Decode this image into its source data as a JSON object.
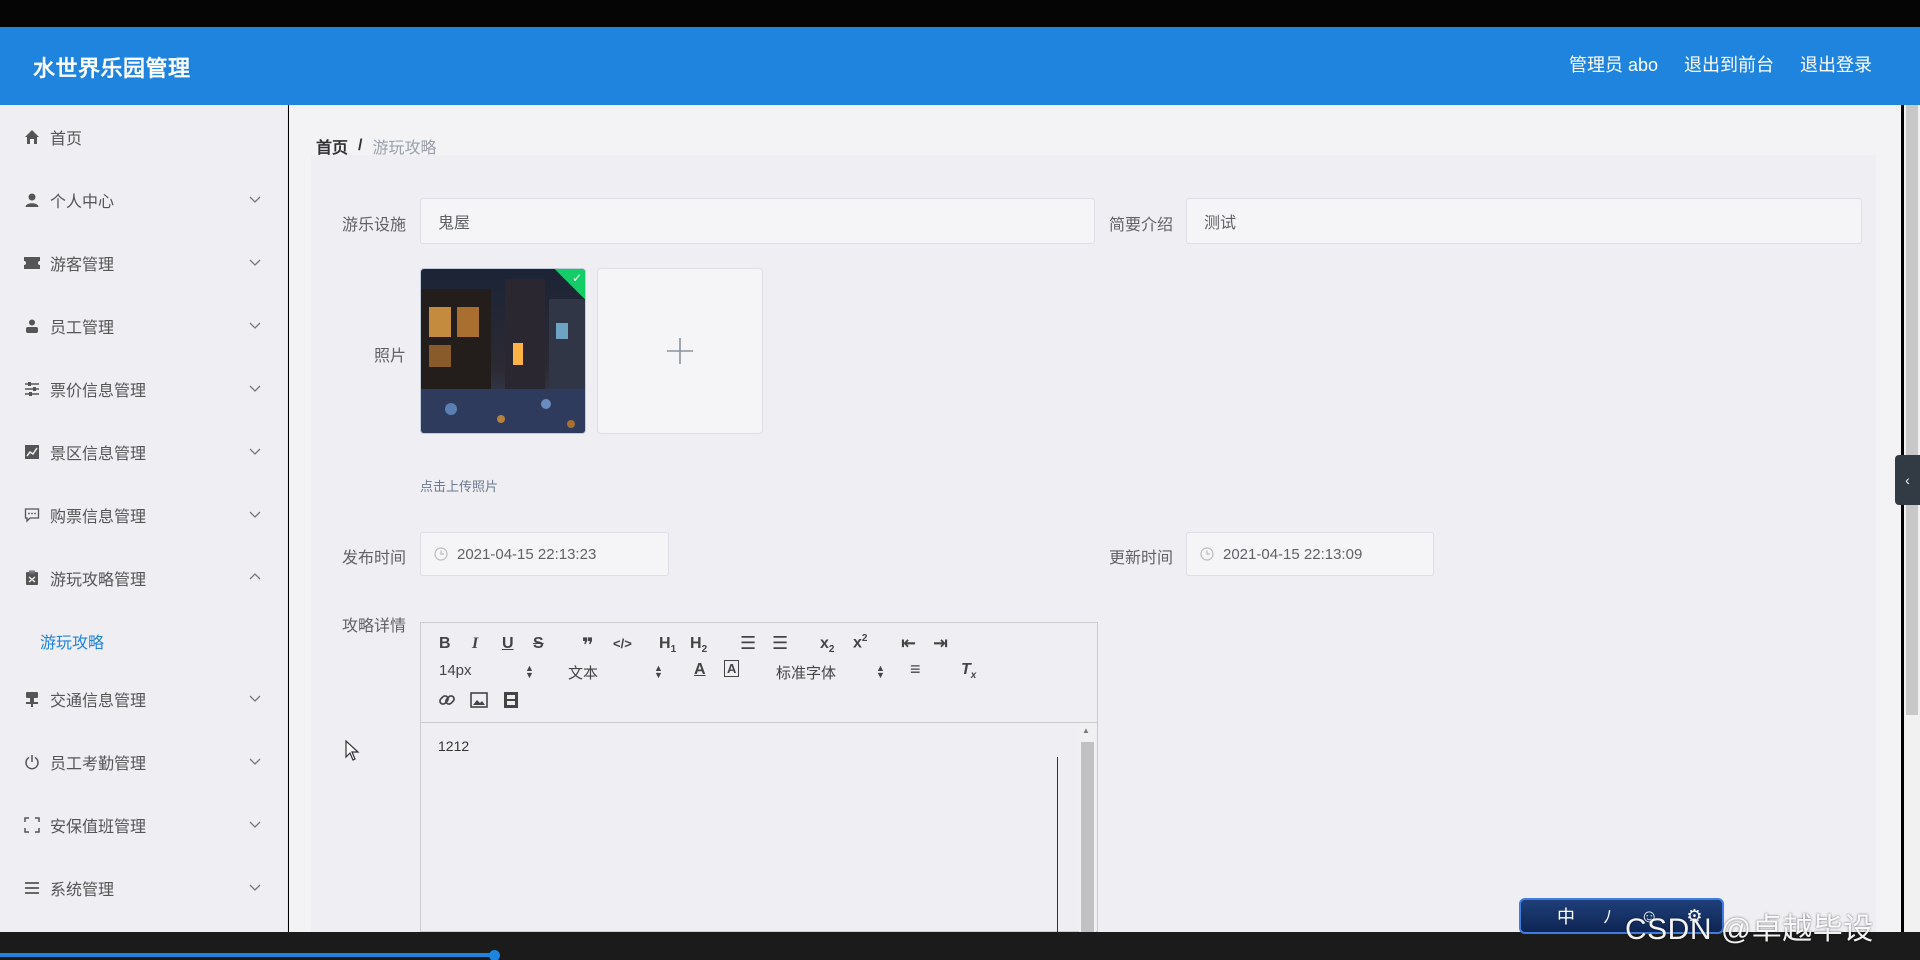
{
  "header": {
    "brand": "水世界乐园管理",
    "nav": [
      "管理员 abo",
      "退出到前台",
      "退出登录"
    ]
  },
  "sidebar": {
    "items": [
      {
        "label": "首页",
        "icon": "home-icon",
        "has_arrow": false
      },
      {
        "label": "个人中心",
        "icon": "user-icon",
        "has_arrow": true
      },
      {
        "label": "游客管理",
        "icon": "ticket-icon",
        "has_arrow": true
      },
      {
        "label": "员工管理",
        "icon": "person-icon",
        "has_arrow": true
      },
      {
        "label": "票价信息管理",
        "icon": "sliders-icon",
        "has_arrow": true
      },
      {
        "label": "景区信息管理",
        "icon": "chart-icon",
        "has_arrow": true
      },
      {
        "label": "购票信息管理",
        "icon": "comment-icon",
        "has_arrow": true
      },
      {
        "label": "游玩攻略管理",
        "icon": "clipboard-icon",
        "has_arrow": true,
        "expanded": true
      },
      {
        "label": "交通信息管理",
        "icon": "stamp-icon",
        "has_arrow": true
      },
      {
        "label": "员工考勤管理",
        "icon": "power-icon",
        "has_arrow": true
      },
      {
        "label": "安保值班管理",
        "icon": "fullscreen-icon",
        "has_arrow": true
      },
      {
        "label": "系统管理",
        "icon": "list-icon",
        "has_arrow": true
      }
    ],
    "active_sub": "游玩攻略"
  },
  "breadcrumb": {
    "home": "首页",
    "sep": "/",
    "current": "游玩攻略"
  },
  "form": {
    "facility_label": "游乐设施",
    "facility_value": "鬼屋",
    "intro_label": "简要介绍",
    "intro_value": "测试",
    "photo_label": "照片",
    "upload_hint": "点击上传照片",
    "publish_label": "发布时间",
    "publish_value": "2021-04-15 22:13:23",
    "update_label": "更新时间",
    "update_value": "2021-04-15 22:13:09",
    "detail_label": "攻略详情"
  },
  "editor": {
    "font_size": "14px",
    "header_select": "文本",
    "font_family": "标准字体",
    "content": "1212"
  },
  "overlay": {
    "ime": [
      "中",
      "ﾉ",
      "☺",
      "⚙"
    ],
    "watermark": "CSDN @卓越毕设"
  },
  "colors": {
    "primary": "#1f84de",
    "success": "#13ce66",
    "sidebar_bg": "#eeeef3"
  }
}
